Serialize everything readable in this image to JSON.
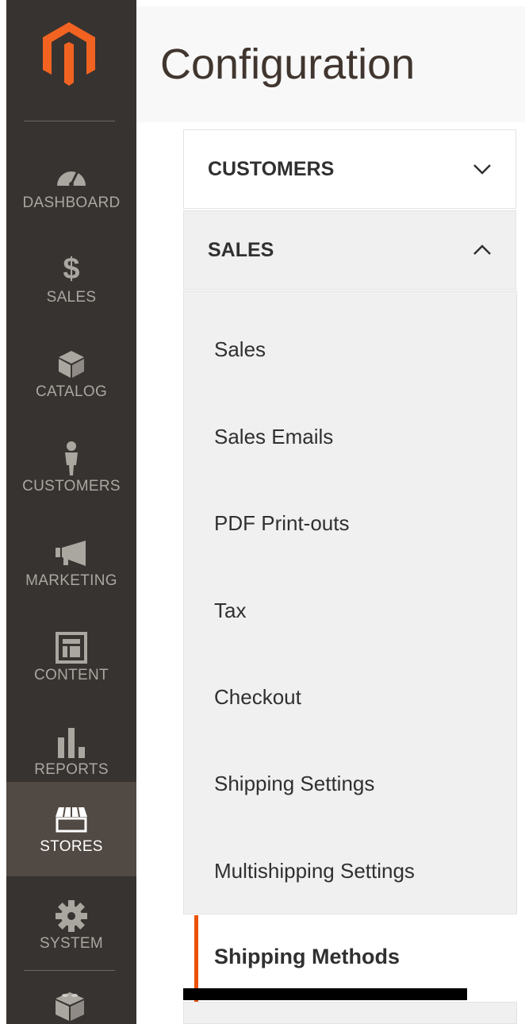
{
  "header": {
    "title": "Configuration"
  },
  "sidebar": {
    "items": [
      {
        "label": "DASHBOARD",
        "icon": "dashboard-icon"
      },
      {
        "label": "SALES",
        "icon": "dollar-icon"
      },
      {
        "label": "CATALOG",
        "icon": "box-icon"
      },
      {
        "label": "CUSTOMERS",
        "icon": "person-icon"
      },
      {
        "label": "MARKETING",
        "icon": "megaphone-icon"
      },
      {
        "label": "CONTENT",
        "icon": "layout-icon"
      },
      {
        "label": "REPORTS",
        "icon": "bar-chart-icon"
      },
      {
        "label": "STORES",
        "icon": "storefront-icon"
      },
      {
        "label": "SYSTEM",
        "icon": "gear-icon"
      }
    ],
    "active": "STORES",
    "bottom_icon": "extensions-blocks-icon"
  },
  "sections": {
    "customers": "CUSTOMERS",
    "sales": "SALES"
  },
  "sales_items": [
    "Sales",
    "Sales Emails",
    "PDF Print-outs",
    "Tax",
    "Checkout",
    "Shipping Settings",
    "Multishipping Settings"
  ],
  "active_item": "Shipping Methods",
  "colors": {
    "sidebar_bg": "#373330",
    "sidebar_active_bg": "#514943",
    "accent": "#eb5202",
    "logo": "#f26322"
  }
}
